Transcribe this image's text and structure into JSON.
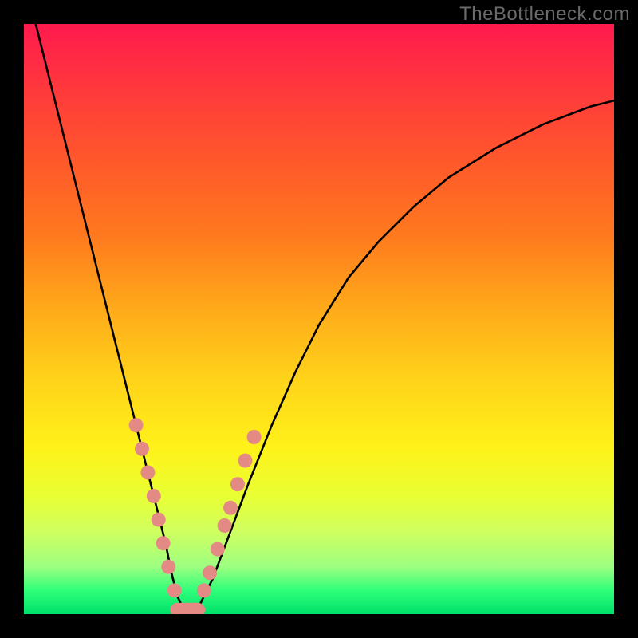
{
  "watermark": "TheBottleneck.com",
  "colors": {
    "frame_bg": "#000000",
    "curve": "#000000",
    "marker": "#e48a84",
    "gradient_top": "#ff1a4d",
    "gradient_bottom": "#00e06a"
  },
  "chart_data": {
    "type": "line",
    "title": "",
    "xlabel": "",
    "ylabel": "",
    "xlim": [
      0,
      100
    ],
    "ylim": [
      0,
      100
    ],
    "grid": false,
    "series": [
      {
        "name": "bottleneck-curve",
        "x": [
          2,
          5,
          8,
          11,
          14,
          17,
          19,
          21,
          22.5,
          24,
          25,
          26,
          27,
          28,
          29.5,
          32,
          35,
          38,
          42,
          46,
          50,
          55,
          60,
          66,
          72,
          80,
          88,
          96,
          100
        ],
        "y": [
          100,
          88,
          76,
          64,
          52,
          40,
          32,
          24,
          18,
          12,
          7,
          3,
          1,
          0.5,
          1,
          6,
          14,
          22,
          32,
          41,
          49,
          57,
          63,
          69,
          74,
          79,
          83,
          86,
          87
        ]
      }
    ],
    "markers": {
      "name": "highlighted-points",
      "left_branch": [
        {
          "x": 19.0,
          "y": 32
        },
        {
          "x": 20.0,
          "y": 28
        },
        {
          "x": 21.0,
          "y": 24
        },
        {
          "x": 22.0,
          "y": 20
        },
        {
          "x": 22.8,
          "y": 16
        },
        {
          "x": 23.6,
          "y": 12
        },
        {
          "x": 24.5,
          "y": 8
        },
        {
          "x": 25.5,
          "y": 4
        }
      ],
      "right_branch": [
        {
          "x": 30.5,
          "y": 4
        },
        {
          "x": 31.5,
          "y": 7
        },
        {
          "x": 32.8,
          "y": 11
        },
        {
          "x": 34.0,
          "y": 15
        },
        {
          "x": 35.0,
          "y": 18
        },
        {
          "x": 36.2,
          "y": 22
        },
        {
          "x": 37.5,
          "y": 26
        },
        {
          "x": 39.0,
          "y": 30
        }
      ],
      "trough": {
        "x_start": 26.0,
        "x_end": 29.5,
        "y": 0.7
      }
    }
  }
}
